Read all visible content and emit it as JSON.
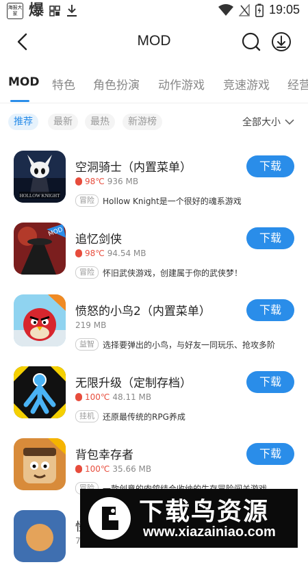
{
  "status_bar": {
    "app_badge_text": "海报大家",
    "bao_glyph": "爆",
    "time": "19:05"
  },
  "header": {
    "title": "MOD"
  },
  "tabs": [
    {
      "label": "MOD",
      "active": true
    },
    {
      "label": "特色"
    },
    {
      "label": "角色扮演"
    },
    {
      "label": "动作游戏"
    },
    {
      "label": "竞速游戏"
    },
    {
      "label": "经营"
    }
  ],
  "filters": {
    "chips": [
      "推荐",
      "最新",
      "最热",
      "新游榜"
    ],
    "size_label": "全部大小"
  },
  "apps": [
    {
      "name": "空洞骑士（内置菜单）",
      "temp": "98℃",
      "size": "936 MB",
      "tag": "冒险",
      "desc": "Hollow Knight是一个很好的魂系游戏",
      "button": "下载"
    },
    {
      "name": "追忆剑侠",
      "temp": "98℃",
      "size": "94.54 MB",
      "tag": "冒险",
      "desc": "怀旧武侠游戏，创建属于你的武侠梦！",
      "button": "下载"
    },
    {
      "name": "愤怒的小鸟2（内置菜单）",
      "temp": "",
      "size": "219 MB",
      "tag": "益智",
      "desc": "选择要弹出的小鸟，与好友一同玩乐、抢攻多阶",
      "button": "下载"
    },
    {
      "name": "无限升级（定制存档）",
      "temp": "100℃",
      "size": "48.11 MB",
      "tag": "挂机",
      "desc": "还原最传统的RPG养成",
      "button": "下载"
    },
    {
      "name": "背包幸存者",
      "temp": "100℃",
      "size": "35.66 MB",
      "tag": "冒险",
      "desc": "一款创意的肉鸽结合收纳的生存冒险闯关游戏",
      "button": "下载"
    },
    {
      "name": "怪",
      "temp": "",
      "size": "7",
      "tag": "",
      "desc": "",
      "button": ""
    }
  ],
  "watermark": {
    "title": "下载鸟资源",
    "url": "www.xiazainiao.com"
  },
  "colors": {
    "accent": "#2a8de9",
    "hot": "#e74c3c"
  }
}
